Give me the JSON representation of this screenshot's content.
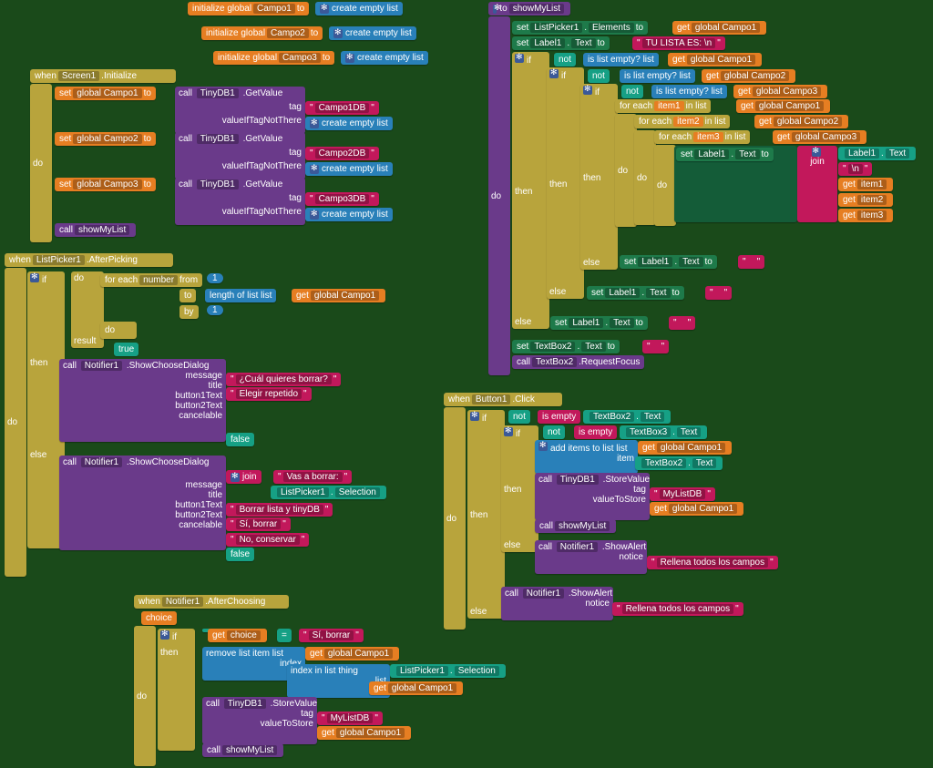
{
  "init": {
    "g1": "initialize global",
    "c1": "Campo1",
    "to": "to",
    "cel": "create empty list",
    "c2": "Campo2",
    "c3": "Campo3"
  },
  "screen1": {
    "when": "when",
    "scr": "Screen1",
    "init": "Initialize",
    "do": "do",
    "set": "set",
    "gc1": "global Campo1",
    "gc2": "global Campo2",
    "gc3": "global Campo3",
    "call": "call",
    "tdb": "TinyDB1",
    "getv": ".GetValue",
    "tag": "tag",
    "c1db": "Campo1DB",
    "c2db": "Campo2DB",
    "c3db": "Campo3DB",
    "vint": "valueIfTagNotThere",
    "cel": "create empty list",
    "sml": "showMyList"
  },
  "lp": {
    "when": "when",
    "lp1": "ListPicker1",
    "ap": ".AfterPicking",
    "do": "do",
    "if": "if",
    "fe": "for each",
    "num": "number",
    "from": "from",
    "to": "to",
    "by": "by",
    "n1": "1",
    "lol": "length of list   list",
    "get": "get",
    "gc1": "global Campo1",
    "res": "result",
    "true": "true",
    "then": "then",
    "else": "else",
    "call": "call",
    "not": "Notifier1",
    "scd": ".ShowChooseDialog",
    "msg": "message",
    "title": "title",
    "b1": "button1Text",
    "b2": "button2Text",
    "canc": "cancelable",
    "q1": "¿Cuál quieres borrar?",
    "t1": "Elegir repetido",
    "false": "false",
    "join": "join",
    "vab": "Vas a borrar:",
    "sel": "Selection",
    "t2": "Borrar lista y tinyDB",
    "sib": "Sí, borrar",
    "noc": "No, conservar"
  },
  "nac": {
    "when": "when",
    "not": "Notifier1",
    "ac": ".AfterChoosing",
    "ch": "choice",
    "do": "do",
    "if": "if",
    "get": "get",
    "eq": "=",
    "sib": "Sí, borrar",
    "then": "then",
    "rli": "remove list item  list",
    "idx": "index",
    "iil": "index in list  thing",
    "list": "list",
    "lp1": "ListPicker1",
    "sel": "Selection",
    "gc1": "global Campo1",
    "call": "call",
    "tdb": "TinyDB1",
    "sv": ".StoreValue",
    "tag": "tag",
    "mldb": "MyListDB",
    "vts": "valueToStore",
    "sml": "showMyList"
  },
  "sml": {
    "to": "to",
    "name": "showMyList",
    "do": "do",
    "set": "set",
    "lp1": "ListPicker1",
    "el": "Elements",
    "get": "get",
    "gc1": "global Campo1",
    "lbl": "Label1",
    "txt": "Text",
    "tul": "TU LISTA ES: \\n",
    "if": "if",
    "not": "not",
    "ile": "is list empty?   list",
    "gc2": "global Campo2",
    "gc3": "global Campo3",
    "then": "then",
    "else": "else",
    "fe": "for each",
    "i1": "item1",
    "i2": "item2",
    "i3": "item3",
    "inl": "in list",
    "join": "join",
    "nl": "\\n",
    "blank": " ",
    "tb2": "TextBox2",
    "rf": ".RequestFocus",
    "call": "call"
  },
  "btn": {
    "when": "when",
    "b1": "Button1",
    "clk": ".Click",
    "do": "do",
    "if": "if",
    "not": "not",
    "ie": "is empty",
    "tb2": "TextBox2",
    "tb3": "TextBox3",
    "txt": "Text",
    "then": "then",
    "else": "else",
    "ail": "add items to list    list",
    "item": "item",
    "get": "get",
    "gc1": "global Campo1",
    "call": "call",
    "tdb": "TinyDB1",
    "sv": ".StoreValue",
    "tag": "tag",
    "mldb": "MyListDB",
    "vts": "valueToStore",
    "sml": "showMyList",
    "not1": "Notifier1",
    "sa": ".ShowAlert",
    "notice": "notice",
    "rtlc": "Rellena todos los campos"
  }
}
